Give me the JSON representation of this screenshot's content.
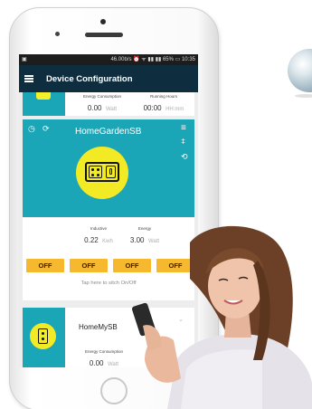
{
  "status_bar": {
    "left": "▣",
    "right": "46.00b/s  ⏰ ᯤ ▮▮ ▮▮ 65% ▭ 10:35"
  },
  "app_bar": {
    "title": "Device Configuration"
  },
  "card_top": {
    "energy_label": "Energy Consumption",
    "energy_value": "0.00",
    "energy_unit": "Watt",
    "hours_label": "Running Hours",
    "hours_value": "00:00",
    "hours_unit": "HH:mm"
  },
  "card_main": {
    "title": "HomeGardenSB",
    "inductive_label": "Inductive",
    "inductive_value": "0.22",
    "inductive_unit": "Kwh",
    "energy_label": "Energy",
    "energy_value": "3.00",
    "energy_unit": "Watt",
    "buttons": [
      "OFF",
      "OFF",
      "OFF",
      "OFF"
    ],
    "hint": "Tap here to sitch On/Off"
  },
  "card_bottom": {
    "title": "HomeMySB",
    "energy_label": "Energy Consumption",
    "energy_value": "0.00",
    "energy_unit": "Watt"
  },
  "colors": {
    "appbar": "#0e2d3e",
    "teal": "#1aa6b7",
    "yellow": "#f2ea25",
    "button": "#f5b82e"
  }
}
